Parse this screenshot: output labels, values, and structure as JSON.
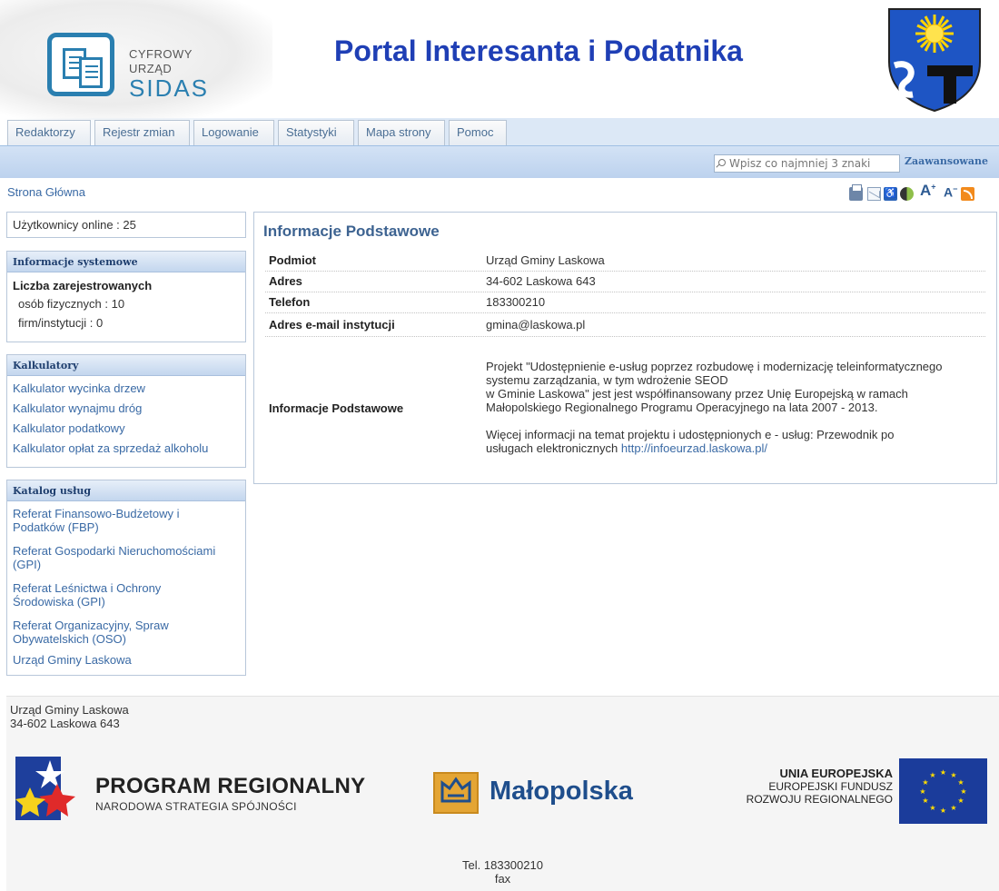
{
  "header": {
    "logo_line1": "CYFROWY",
    "logo_line2": "URZĄD",
    "logo_line3": "SIDAS",
    "title": "Portal Interesanta i Podatnika"
  },
  "tabs": [
    "Redaktorzy",
    "Rejestr zmian",
    "Logowanie",
    "Statystyki",
    "Mapa strony",
    "Pomoc"
  ],
  "search": {
    "placeholder": "Wpisz co najmniej 3 znaki",
    "advanced_label": "Zaawansowane"
  },
  "breadcrumb": "Strona Główna",
  "toolbar": {
    "icons": [
      "print-icon",
      "mail-icon",
      "accessibility-icon",
      "contrast-icon",
      "font-increase-icon",
      "font-decrease-icon",
      "rss-icon"
    ],
    "font_up": "A",
    "font_up_sup": "+",
    "font_down": "A",
    "font_down_sup": "−"
  },
  "sidebar": {
    "online": "Użytkownicy online : 25",
    "system_info": {
      "title": "Informacje systemowe",
      "count_title": "Liczba zarejestrowanych",
      "persons": "osób fizycznych : 10",
      "companies": "firm/instytucji : 0"
    },
    "calculators": {
      "title": "Kalkulatory",
      "items": [
        "Kalkulator wycinka drzew",
        "Kalkulator wynajmu dróg",
        "Kalkulator podatkowy",
        "Kalkulator opłat za sprzedaż alkoholu"
      ]
    },
    "catalog": {
      "title": "Katalog usług",
      "items": [
        [
          "Referat Finansowo-Budżetowy i",
          "Podatków (FBP)"
        ],
        [
          "Referat Gospodarki Nieruchomościami",
          "(GPI)"
        ],
        [
          "Referat Leśnictwa i Ochrony",
          "Środowiska (GPI)"
        ],
        [
          "Referat Organizacyjny, Spraw",
          "Obywatelskich (OSO)"
        ],
        [
          "Urząd Gminy Laskowa"
        ]
      ]
    }
  },
  "main": {
    "title": "Informacje Podstawowe",
    "rows": [
      {
        "label": "Podmiot",
        "value": "Urząd Gminy Laskowa"
      },
      {
        "label": "Adres",
        "value": "34-602 Laskowa 643"
      },
      {
        "label": "Telefon",
        "value": "183300210"
      },
      {
        "label": "Adres e-mail instytucji",
        "value": "gmina@laskowa.pl"
      }
    ],
    "info": {
      "label": "Informacje Podstawowe",
      "p1": [
        "Projekt \"Udostępnienie e-usług poprzez rozbudowę i modernizację teleinformatycznego",
        "systemu zarządzania, w tym wdrożenie SEOD",
        "w Gminie Laskowa\" jest jest współfinansowany przez Unię Europejską w ramach",
        "Małopolskiego Regionalnego Programu Operacyjnego na lata 2007 - 2013."
      ],
      "p2_line1": "Więcej informacji na temat projektu i udostępnionych e - usług: Przewodnik po",
      "p2_line2": "usługach elektronicznych ",
      "link": "http://infoeurzad.laskowa.pl/"
    }
  },
  "footer": {
    "name": "Urząd Gminy Laskowa",
    "address": "34-602 Laskowa 643",
    "program_title": "PROGRAM REGIONALNY",
    "program_sub": "NARODOWA STRATEGIA SPÓJNOŚCI",
    "malopolska": "Małopolska",
    "eu_line1": "UNIA EUROPEJSKA",
    "eu_line2": "EUROPEJSKI FUNDUSZ",
    "eu_line3": "ROZWOJU REGIONALNEGO",
    "tel": "Tel. 183300210",
    "fax": "fax"
  },
  "colors": {
    "title_blue": "#1f3fb5",
    "link_blue": "#3a6aa5",
    "header_bar": "#c3d6ee",
    "eu_blue": "#1b3c9b",
    "eu_star": "#ffdd00"
  }
}
